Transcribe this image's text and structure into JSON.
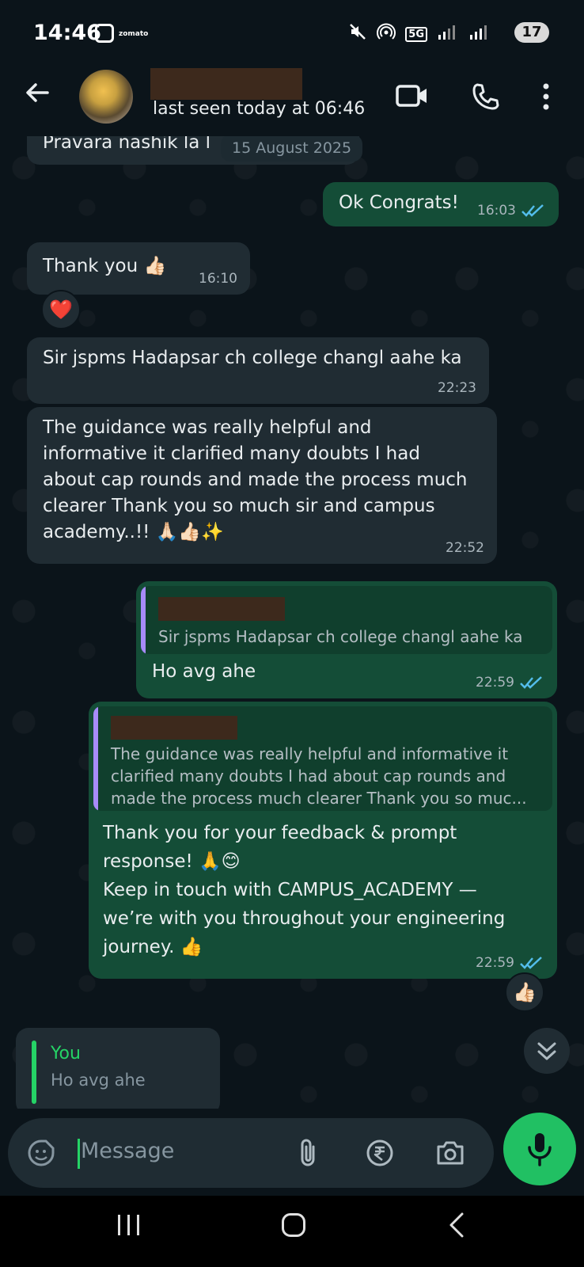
{
  "status_bar": {
    "time": "14:46",
    "app_notification": "zomato",
    "network": "5G",
    "battery": "17"
  },
  "header": {
    "last_seen": "last seen today at 06:46"
  },
  "chat": {
    "partial_top_text": "Pravara nashik la l",
    "date_chip": "15 August 2025",
    "messages": [
      {
        "text": "Ok Congrats!",
        "time": "16:03"
      },
      {
        "text": "Thank you 👍🏻",
        "time": "16:10",
        "reaction": "❤️"
      },
      {
        "text": "Sir jspms Hadapsar ch college changl aahe ka",
        "time": "22:23"
      },
      {
        "text": "The guidance was really helpful and\ninformative it clarified many doubts I had\nabout cap rounds and made the process much\nclearer Thank you so much sir and campus\nacademy..!! 🙏🏻👍🏻✨",
        "time": "22:52"
      },
      {
        "quote": "Sir jspms Hadapsar ch college changl aahe ka",
        "text": "Ho avg ahe",
        "time": "22:59"
      },
      {
        "quote": "The guidance was really helpful and informative it\nclarified many doubts I had about cap rounds and\nmade the process much clearer Thank you so muc...",
        "text": "Thank you for your feedback & prompt\nresponse! 🙏😊\nKeep in touch with CAMPUS_ACADEMY —\nwe’re with you throughout your engineering\njourney. 👍",
        "time": "22:59",
        "reaction": "👍🏻"
      },
      {
        "quote_author": "You",
        "quote_text": "Ho avg ahe"
      }
    ]
  },
  "input": {
    "placeholder": "Message"
  },
  "colors": {
    "incoming": "#202c33",
    "outgoing": "#144d37",
    "accent": "#21c063",
    "ticks": "#53bdeb"
  }
}
